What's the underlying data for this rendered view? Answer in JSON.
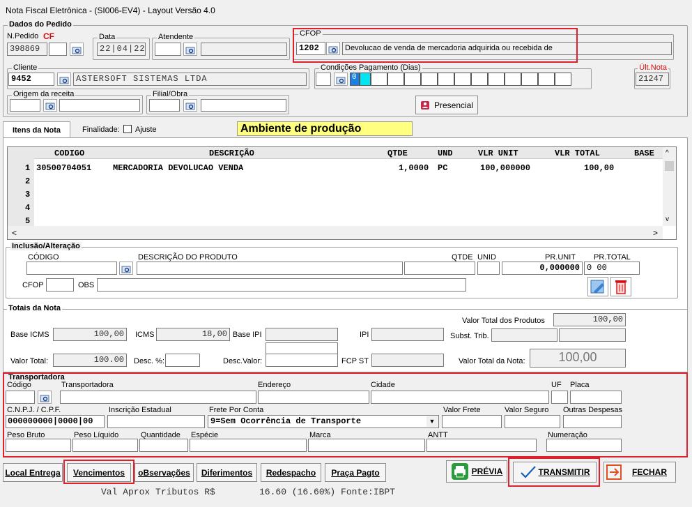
{
  "window": {
    "title": "Nota Fiscal Eletrônica - (SI006-EV4) - Layout Versão 4.0"
  },
  "pedido": {
    "group_label": "Dados do Pedido",
    "npedido_label": "N.Pedido",
    "npedido_tag": "CF",
    "npedido_value": "398869",
    "data_label": "Data",
    "data_d": "22",
    "data_m": "04",
    "data_y": "22",
    "atendente_label": "Atendente",
    "cfop_label": "CFOP",
    "cfop_code": "1202",
    "cfop_desc": "Devolucao de venda de mercadoria adquirida ou recebida de",
    "cliente_label": "Cliente",
    "cliente_code": "9452",
    "cliente_name": "ASTERSOFT SISTEMAS LTDA",
    "condicoes_label": "Condições Pagamento (Dias)",
    "condicoes_first": "0",
    "ultnota_label": "Últ.Nota",
    "ultnota_value": "21247",
    "origem_label": "Origem da receita",
    "filial_label": "Filial/Obra",
    "presencial_label": "Presencial"
  },
  "tabs": {
    "itens_label": "Itens da Nota",
    "finalidade_label": "Finalidade:",
    "ajuste_label": "Ajuste",
    "ambiente": "Ambiente de produção"
  },
  "grid": {
    "headers": {
      "codigo": "CODIGO",
      "descricao": "DESCRIÇÃO",
      "qtde": "QTDE",
      "und": "UND",
      "vlr_unit": "VLR UNIT",
      "vlr_total": "VLR TOTAL",
      "base": "BASE"
    },
    "row_numbers": [
      "1",
      "2",
      "3",
      "4",
      "5"
    ],
    "rows": [
      {
        "codigo": "30500704051",
        "descricao": "MERCADORIA DEVOLUCAO VENDA",
        "qtde": "1,0000",
        "und": "PC",
        "vlr_unit": "100,000000",
        "vlr_total": "100,00"
      }
    ]
  },
  "inclusao": {
    "group_label": "Inclusão/Alteração",
    "codigo_label": "CÓDIGO",
    "descricao_label": "DESCRIÇÃO DO PRODUTO",
    "qtde_label": "QTDE",
    "unid_label": "UNID",
    "prunit_label": "PR.UNIT",
    "prtotal_label": "PR.TOTAL",
    "prunit_value": "0,000000",
    "prtotal_value": "0 00",
    "cfop_label": "CFOP",
    "obs_label": "OBS"
  },
  "totais": {
    "group_label": "Totais da Nota",
    "base_icms_label": "Base ICMS",
    "base_icms": "100,00",
    "icms_label": "ICMS",
    "icms": "18,00",
    "base_ipi_label": "Base IPI",
    "ipi_label": "IPI",
    "vtp_label": "Valor Total dos Produtos",
    "vtp": "100,00",
    "subst_label": "Subst. Trib.",
    "valor_total_label": "Valor Total:",
    "valor_total": "100.00",
    "desc_pct_label": "Desc. %:",
    "desc_valor_label": "Desc.Valor:",
    "fcp_label": "FCP ST",
    "vtn_label": "Valor Total da Nota:",
    "vtn": "100,00"
  },
  "transp": {
    "group_label": "Transportadora",
    "codigo_label": "Código",
    "transportadora_label": "Transportadora",
    "endereco_label": "Endereço",
    "cidade_label": "Cidade",
    "uf_label": "UF",
    "placa_label": "Placa",
    "cnpj_label": "C.N.P.J. / C.P.F.",
    "cnpj_a": "000000000",
    "cnpj_b": "0000",
    "cnpj_c": "00",
    "ie_label": "Inscrição Estadual",
    "frete_label": "Frete Por Conta",
    "frete_value": "9=Sem Ocorrência de Transporte",
    "valor_frete_label": "Valor Frete",
    "valor_seguro_label": "Valor Seguro",
    "outras_label": "Outras Despesas",
    "peso_bruto_label": "Peso Bruto",
    "peso_liquido_label": "Peso Líquido",
    "quantidade_label": "Quantidade",
    "especie_label": "Espécie",
    "marca_label": "Marca",
    "antt_label": "ANTT",
    "numeracao_label": "Numeração"
  },
  "buttons": {
    "local_entrega": "Local Entrega",
    "vencimentos": "Vencimentos",
    "observacoes": "oBservações",
    "diferimentos": "Diferimentos",
    "redespacho": "Redespacho",
    "praca": "Praça Pagto",
    "previa": "PRÉVIA",
    "transmitir": "TRANSMITIR",
    "fechar": "FECHAR"
  },
  "footer": {
    "tributos": "Val Aprox Tributos R$",
    "tributos_value": "16.60 (16.60%) Fonte:IBPT"
  },
  "colors": {
    "highlight_red": "#e0202a",
    "ambiente_bg": "#ffff80",
    "accent": "#1a5fb4"
  }
}
